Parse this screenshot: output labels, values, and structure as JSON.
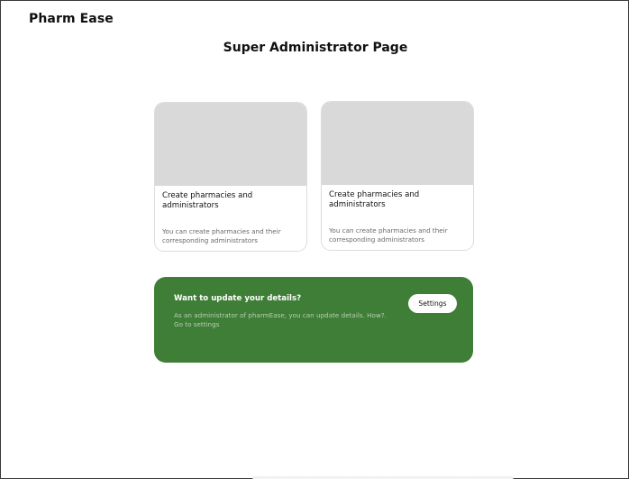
{
  "app": {
    "brand": "Pharm Ease"
  },
  "page": {
    "title": "Super Administrator Page"
  },
  "cards": [
    {
      "title": "Create pharmacies and administrators",
      "description": "You can create pharmacies and their corresponding administrators"
    },
    {
      "title": "Create pharmacies and administrators",
      "description": "You can create pharmacies and their corresponding administrators"
    }
  ],
  "promo": {
    "title": "Want to update your details?",
    "text": "As an administrator of pharmEase, you can update details. How?. Go to settings",
    "button_label": "Settings"
  },
  "colors": {
    "accent_green": "#3f7e37",
    "card_placeholder": "#d9d9d9"
  }
}
